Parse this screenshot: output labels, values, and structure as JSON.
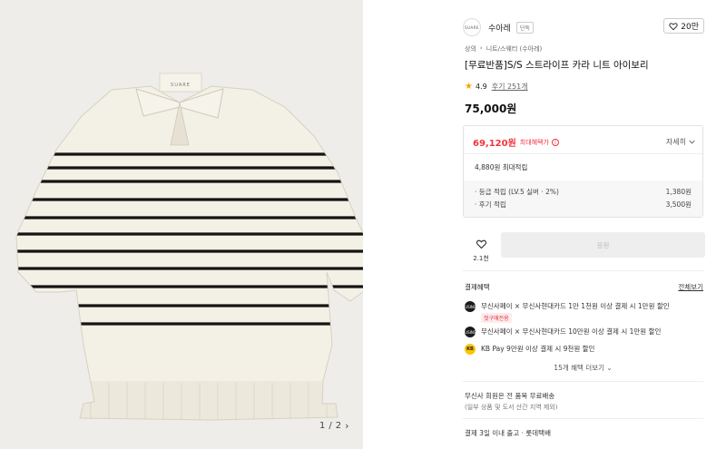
{
  "gallery": {
    "tag_text": "SUARE",
    "pager": {
      "current": "1",
      "separator": "/",
      "total": "2",
      "next_glyph": "›"
    }
  },
  "brand": {
    "logo_text": "SUARE",
    "name": "수아레",
    "badge": "단독",
    "like_count": "20만"
  },
  "breadcrumb": [
    "상의",
    "›",
    "니트/스웨터 (수아레)"
  ],
  "product": {
    "title": "[무료반품]S/S 스트라이프 카라 니트 아이보리",
    "rating": "4.9",
    "review_label": "후기 251개",
    "price": "75,000원"
  },
  "benefit": {
    "max_price": "69,120원",
    "max_label": "최대혜택가",
    "info_icon": "i",
    "detail_label": "자세히",
    "max_points": "4,880원 최대적립",
    "rows": [
      {
        "label": "· 등급 적립 (LV.5 실버 · 2%)",
        "value": "1,380원"
      },
      {
        "label": "· 후기 적립",
        "value": "3,500원"
      }
    ]
  },
  "purchase": {
    "fav_count": "2.1천",
    "buy_label": "응원"
  },
  "payment": {
    "title": "결제혜택",
    "all_label": "전체보기",
    "cards": [
      {
        "icon_text": "MUSINSA",
        "text": "무신사페이 × 무신사현대카드 1만 1천원 이상 결제 시 1만원 할인",
        "sub": "첫구매전용"
      },
      {
        "icon_text": "MUSINSA",
        "text": "무신사페이 × 무신사현대카드 10만원 이상 결제 시 1만원 할인",
        "sub": ""
      },
      {
        "icon_text": "KB",
        "text": "KB Pay 9만원 이상 결제 시 9천원 할인",
        "sub": ""
      }
    ],
    "more_label": "15개 혜택 더보기 ⌄"
  },
  "shipping": {
    "line1": "무신사 회원은 전 품목 무료배송",
    "line2": "(일부 상품 및 도서 산간 지역 제외)",
    "line3": "결제 3일 이내 출고 · 롯데택배"
  },
  "colors": {
    "accent_red": "#f3333f",
    "sweater": "#f2efe4",
    "stripe": "#111111",
    "bg": "#efedea"
  }
}
